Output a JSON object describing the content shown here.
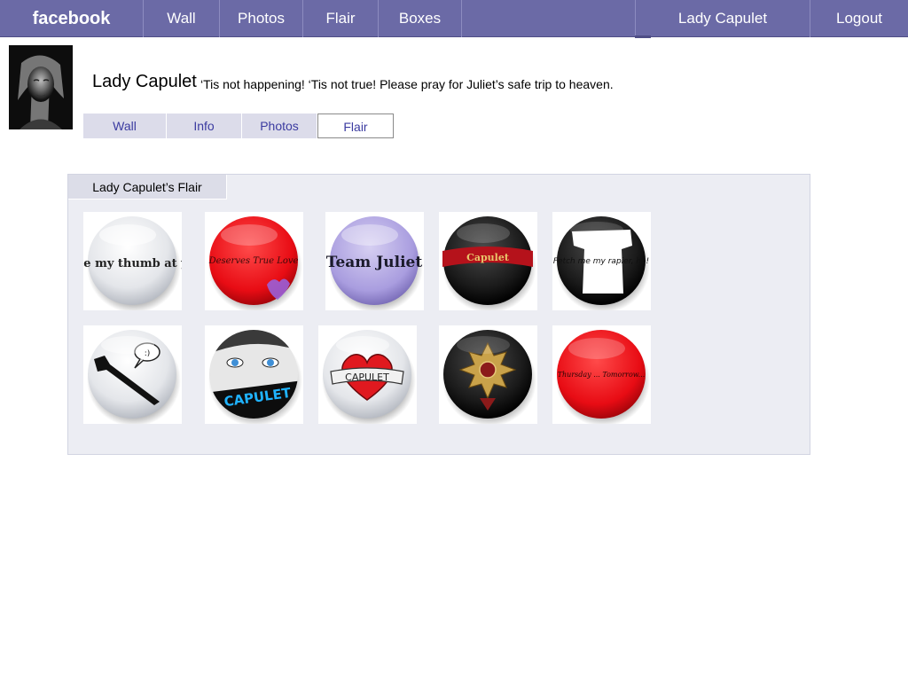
{
  "topnav": {
    "logo": "facebook",
    "items": [
      "Wall",
      "Photos",
      "Flair",
      "Boxes"
    ],
    "user": "Lady Capulet",
    "logout": "Logout"
  },
  "profile": {
    "name": "Lady Capulet",
    "status": "‘Tis not happening!  ‘Tis not true!  Please pray for Juliet’s safe trip to heaven."
  },
  "subtabs": [
    "Wall",
    "Info",
    "Photos",
    "Flair"
  ],
  "active_subtab": "Flair",
  "flair": {
    "title": "Lady Capulet’s Flair",
    "badges": [
      {
        "text": "I bite my thumb at you.",
        "theme": "silver"
      },
      {
        "text": "Deserves True Love",
        "theme": "red"
      },
      {
        "text": "Team Juliet",
        "theme": "lavender"
      },
      {
        "text": "Capulet",
        "theme": "black"
      },
      {
        "text": "Fetch me my rapier, ho!",
        "theme": "black"
      },
      {
        "text": ":)",
        "theme": "silver"
      },
      {
        "text": "CAPULET",
        "theme": "silver"
      },
      {
        "text": "CAPULET",
        "theme": "silver"
      },
      {
        "text": "",
        "theme": "black"
      },
      {
        "text": "Thursday ... Tomorrow...",
        "theme": "red"
      }
    ]
  },
  "colors": {
    "nav": "#6b6aa6",
    "tab_link": "#3b3ba0",
    "panel": "#ecedf3"
  }
}
